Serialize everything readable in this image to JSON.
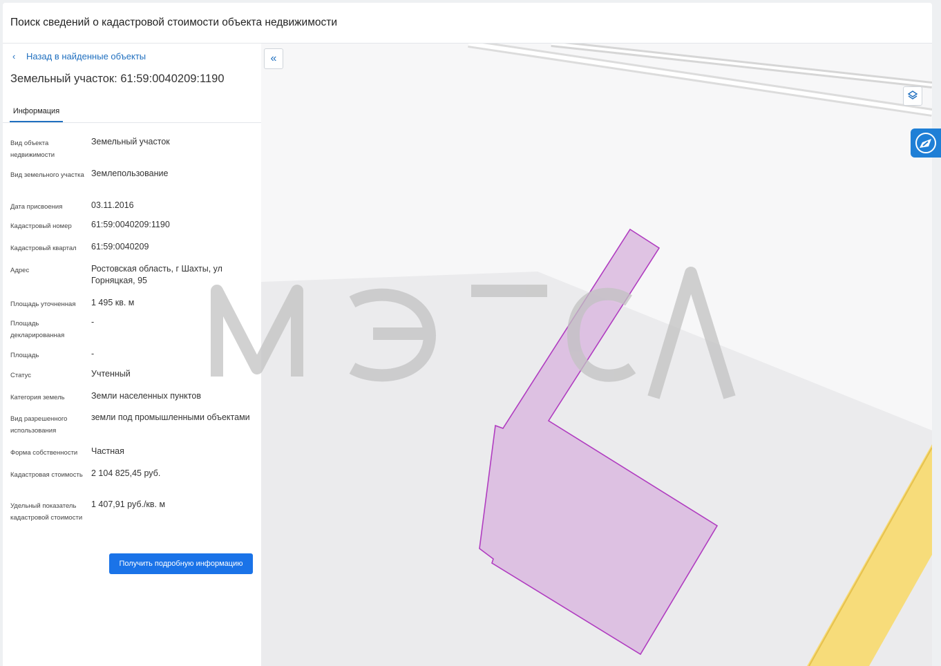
{
  "header": {
    "title": "Поиск сведений о кадастровой стоимости объекта недвижимости"
  },
  "sidebar": {
    "back_label": "Назад в найденные объекты",
    "object_title": "Земельный участок: 61:59:0040209:1190",
    "tab_label": "Информация",
    "rows": [
      {
        "label": "Вид объекта недвижимости",
        "value": "Земельный участок"
      },
      {
        "label": "Вид земельного участка",
        "value": "Землепользование"
      },
      {
        "label": "Дата присвоения",
        "value": "03.11.2016"
      },
      {
        "label": "Кадастровый номер",
        "value": "61:59:0040209:1190"
      },
      {
        "label": "Кадастровый квартал",
        "value": "61:59:0040209"
      },
      {
        "label": "Адрес",
        "value": "Ростовская область, г Шахты, ул Горняцкая, 95"
      },
      {
        "label": "Площадь уточненная",
        "value": "1 495 кв. м"
      },
      {
        "label": "Площадь декларированная",
        "value": "-"
      },
      {
        "label": "Площадь",
        "value": "-"
      },
      {
        "label": "Статус",
        "value": "Учтенный"
      },
      {
        "label": "Категория земель",
        "value": "Земли населенных пунктов"
      },
      {
        "label": "Вид разрешенного использования",
        "value": "земли под промышленными объектами"
      },
      {
        "label": "Форма собственности",
        "value": "Частная"
      },
      {
        "label": "Кадастровая стоимость",
        "value": "2 104 825,45 руб."
      },
      {
        "label": "Удельный показатель кадастровой стоимости",
        "value": "1 407,91 руб./кв. м"
      }
    ],
    "detail_button": "Получить подробную информацию"
  },
  "map": {
    "collapse_icon": "double-chevron-left-icon",
    "layers_icon": "layers-icon",
    "widget_icon": "chat-widget-icon",
    "parcel_fill": "#dcbde0",
    "parcel_stroke": "#b03cc0",
    "road_color": "#f7dc7a"
  },
  "watermark": "МЭТСЛ"
}
